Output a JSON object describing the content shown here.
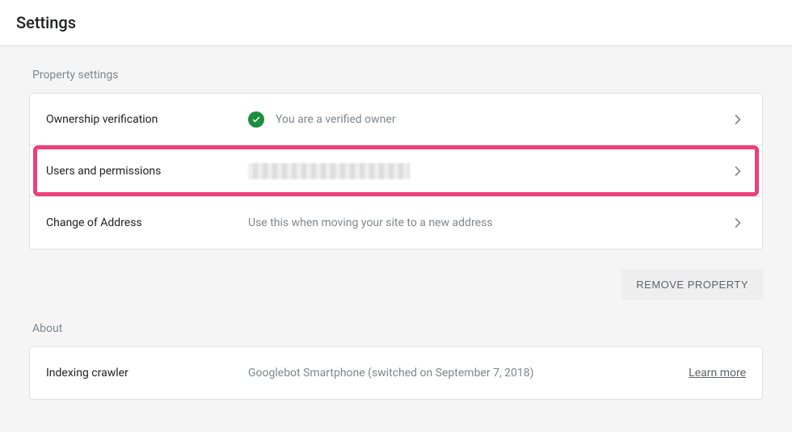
{
  "header": {
    "title": "Settings"
  },
  "sections": {
    "property": {
      "label": "Property settings",
      "rows": {
        "ownership": {
          "label": "Ownership verification",
          "desc": "You are a verified owner"
        },
        "users": {
          "label": "Users and permissions"
        },
        "address": {
          "label": "Change of Address",
          "desc": "Use this when moving your site to a new address"
        }
      },
      "remove_button": "REMOVE PROPERTY"
    },
    "about": {
      "label": "About",
      "rows": {
        "crawler": {
          "label": "Indexing crawler",
          "desc": "Googlebot Smartphone (switched on September 7, 2018)",
          "link": "Learn more"
        }
      }
    }
  }
}
